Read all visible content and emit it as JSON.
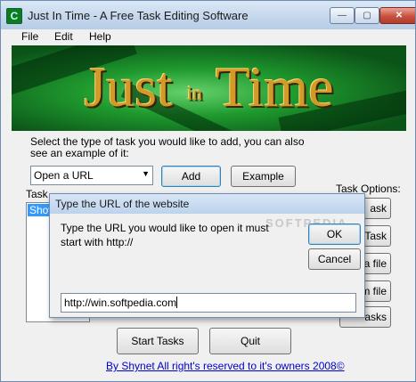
{
  "window": {
    "icon_glyph": "C",
    "title": "Just In Time - A Free Task Editing Software",
    "minimize_glyph": "—",
    "maximize_glyph": "▢",
    "close_glyph": "✕"
  },
  "menu": {
    "file": "File",
    "edit": "Edit",
    "help": "Help"
  },
  "banner": {
    "word1": "Just",
    "word2": "in",
    "word3": "Time"
  },
  "main": {
    "instruction_line1": "Select the type of task you would like to add, you can also",
    "instruction_line2": "see an example of it:",
    "task_type_value": "Open a URL",
    "combo_arrow": "▼",
    "add_label": "Add",
    "example_label": "Example",
    "tasks_label_partial": "Task",
    "tasks_list_selected": "Show",
    "task_options_label": "Task Options:",
    "option_buttons": [
      "ask",
      "Task",
      "a file",
      "m file",
      "asks"
    ],
    "start_tasks_label": "Start Tasks",
    "quit_label": "Quit",
    "footer": "By Shynet All right's reserved to it's owners 2008©"
  },
  "dialog": {
    "title": "Type the URL of the website",
    "message": "Type the URL you would like to open it must start with http://",
    "ok_label": "OK",
    "cancel_label": "Cancel",
    "url_value": "http://win.softpedia.com",
    "watermark": "SOFTPEDIA"
  }
}
